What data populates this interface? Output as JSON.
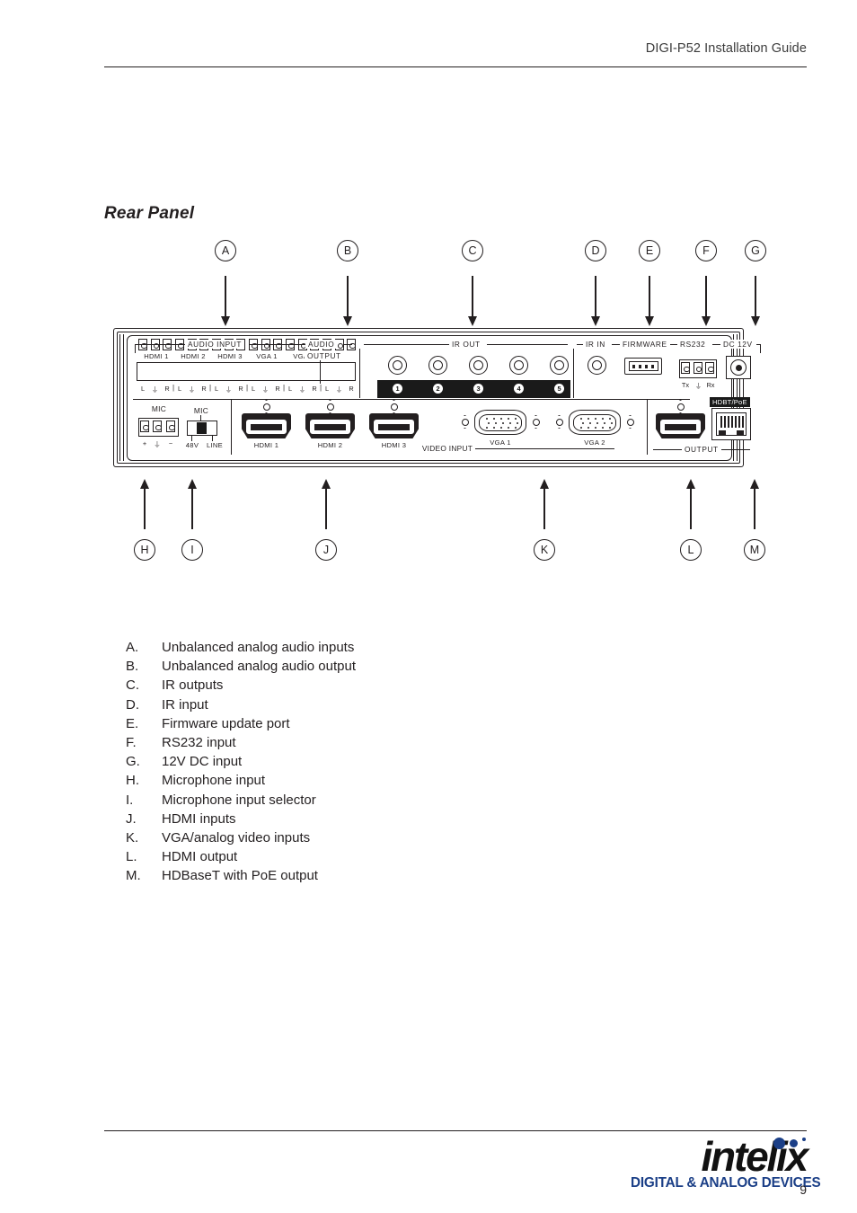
{
  "header": {
    "title": "DIGI-P52 Installation Guide"
  },
  "section": {
    "title": "Rear Panel"
  },
  "panel": {
    "groups": {
      "audio_input": "AUDIO INPUT",
      "audio_output_l1": "AUDIO",
      "audio_output_l2": "OUTPUT",
      "ir_out": "IR OUT",
      "ir_in": "IR IN",
      "firmware": "FIRMWARE",
      "rs232": "RS232",
      "dc12v": "DC 12V",
      "video_input": "VIDEO INPUT",
      "output": "OUTPUT"
    },
    "audio_input_channels": [
      "HDMI 1",
      "HDMI 2",
      "HDMI 3",
      "VGA 1",
      "VGA 2"
    ],
    "audio_pin_labels": [
      "L",
      "⏚",
      "R"
    ],
    "ir_out_numbers": [
      "1",
      "2",
      "3",
      "4",
      "5"
    ],
    "rs232_pins": [
      "Tx",
      "⏚",
      "Rx"
    ],
    "mic": {
      "terminal_label": "MIC",
      "terminal_pins": [
        "+",
        "⏚",
        "−"
      ],
      "switch_label": "MIC",
      "switch_pos_left": "48V",
      "switch_pos_right": "LINE"
    },
    "hdmi_inputs": [
      "HDMI 1",
      "HDMI 2",
      "HDMI 3"
    ],
    "vga_inputs": [
      "VGA 1",
      "VGA 2"
    ],
    "hdbt_tag": "HDBT/PoE"
  },
  "callouts_top": [
    {
      "letter": "A"
    },
    {
      "letter": "B"
    },
    {
      "letter": "C"
    },
    {
      "letter": "D"
    },
    {
      "letter": "E"
    },
    {
      "letter": "F"
    },
    {
      "letter": "G"
    }
  ],
  "callouts_bottom": [
    {
      "letter": "H"
    },
    {
      "letter": "I"
    },
    {
      "letter": "J"
    },
    {
      "letter": "K"
    },
    {
      "letter": "L"
    },
    {
      "letter": "M"
    }
  ],
  "legend": [
    {
      "key": "A.",
      "text": "Unbalanced analog audio inputs"
    },
    {
      "key": "B.",
      "text": "Unbalanced analog audio output"
    },
    {
      "key": "C.",
      "text": "IR outputs"
    },
    {
      "key": "D.",
      "text": "IR input"
    },
    {
      "key": "E.",
      "text": "Firmware update port"
    },
    {
      "key": "F.",
      "text": "RS232 input"
    },
    {
      "key": "G.",
      "text": "12V DC input"
    },
    {
      "key": "H.",
      "text": "Microphone input"
    },
    {
      "key": "I.",
      "text": "Microphone input selector"
    },
    {
      "key": "J.",
      "text": "HDMI inputs"
    },
    {
      "key": "K.",
      "text": "VGA/analog video inputs"
    },
    {
      "key": "L.",
      "text": "HDMI output"
    },
    {
      "key": "M.",
      "text": "HDBaseT with PoE output"
    }
  ],
  "footer": {
    "logo_word": "intelix",
    "logo_tagline": "DIGITAL & ANALOG DEVICES",
    "page_number": "9",
    "brand_color": "#1b3f87"
  }
}
